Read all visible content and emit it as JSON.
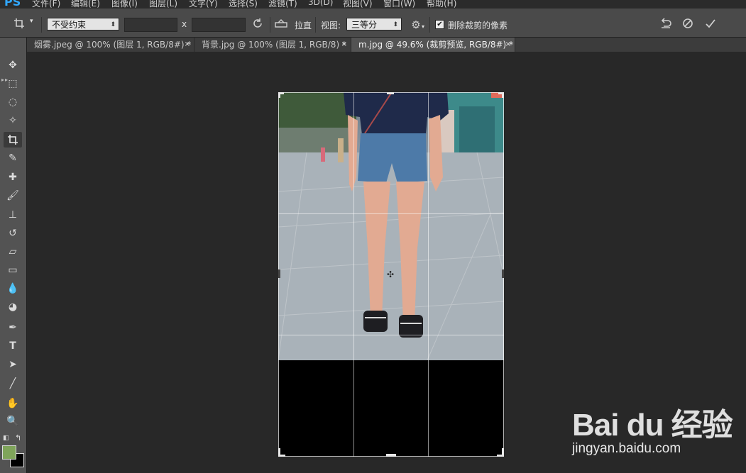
{
  "app": {
    "logo": "PS"
  },
  "menu": [
    "文件(F)",
    "编辑(E)",
    "图像(I)",
    "图层(L)",
    "文字(Y)",
    "选择(S)",
    "滤镜(T)",
    "3D(D)",
    "视图(V)",
    "窗口(W)",
    "帮助(H)"
  ],
  "options": {
    "ratio_preset": "不受约束",
    "width_value": "",
    "times_sign": "x",
    "height_value": "",
    "straighten_label": "拉直",
    "view_label": "视图:",
    "view_value": "三等分",
    "delete_cropped_label": "删除裁剪的像素",
    "delete_cropped_checked": true
  },
  "tabs": [
    {
      "label": "烟雾.jpeg @ 100% (图层 1, RGB/8#) *",
      "active": false
    },
    {
      "label": "背景.jpg @ 100% (图层 1, RGB/8) *",
      "active": false
    },
    {
      "label": "m.jpg @ 49.6% (裁剪预览, RGB/8#) *",
      "active": true
    }
  ],
  "tab_close_glyph": "×",
  "tools": [
    "move-tool",
    "marquee-tool",
    "lasso-tool",
    "magic-wand-tool",
    "crop-tool",
    "eyedropper-tool",
    "healing-brush-tool",
    "brush-tool",
    "clone-stamp-tool",
    "history-brush-tool",
    "eraser-tool",
    "gradient-tool",
    "blur-tool",
    "dodge-tool",
    "pen-tool",
    "type-tool",
    "path-selection-tool",
    "line-tool",
    "hand-tool",
    "zoom-tool"
  ],
  "active_tool": "crop-tool",
  "colors": {
    "foreground": "#7fa45a",
    "background": "#000000",
    "accent": "#31a8ff"
  },
  "watermark": {
    "logo": "Bai du 经验",
    "url": "jingyan.baidu.com"
  }
}
